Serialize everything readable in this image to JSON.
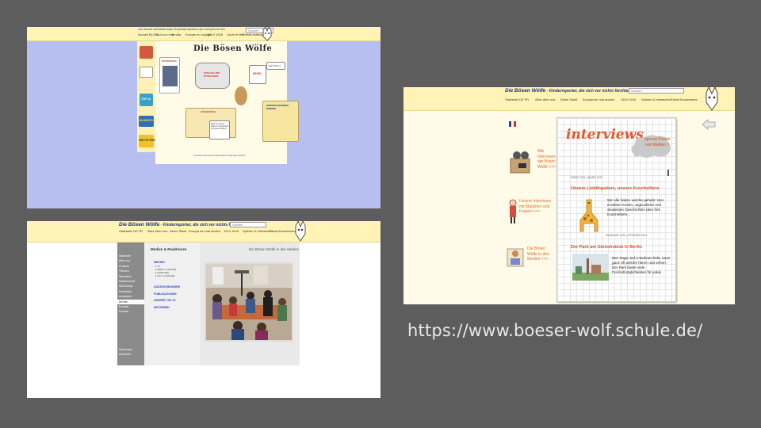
{
  "url_caption": "https://www.boeser-wolf.schule.de/",
  "shot1": {
    "tagline": "Les Grands méchants loups, les jeunes reporters qui n'ont peur de rien",
    "search_value": "Suchen",
    "nav": [
      "Accueil BLOG",
      "Tout sur nous",
      "Ta villa",
      "Europe en voyage",
      "1914 1918",
      "Jouer et fête",
      "Portail enfants"
    ],
    "logo_text": "Die Bösen Wölfe",
    "tiles": {
      "interviews": "INTERVIEWS",
      "spielen": "SPIELEN UND MITMACHEN",
      "news": "NEWS",
      "deutsch": "DEUTSCH",
      "europa": "EUROPA ERLEBEN · WISSEN",
      "frankreich": "FRANKREICH",
      "note": "Bald ist Advent Paket in Frankreich und Deutschland"
    },
    "sidebar": [
      "TOP 10",
      "BLINDE KUH",
      "BETTE ESSEN"
    ],
    "footer": "Kontakt  Impressum  Datenschutz  Sitemap  Partner"
  },
  "shot2": {
    "title_main": "Die Bösen Wölfe",
    "title_sub": " - Kinderreporter, die sich vor nichts fürchten",
    "search_value": "Suchen",
    "nav": [
      "Startseite DE FR",
      "Alles über uns",
      "Deine Stadt",
      "Europa ein mal anders",
      "1914 1918",
      "Spielen & mitmachen",
      "Portal Erwachsene"
    ],
    "panel_title": "Medien & Reaktionen",
    "content_title": "Die Bösen Wölfe in den Medien",
    "left_nav": [
      "Startseite",
      "Über uns",
      "Projekte",
      "Themen",
      "Interviews",
      "Wettbewerbe",
      "Workshops",
      "Interaktion",
      "Austausch",
      "Medien",
      "Kontakt",
      "Kontakt"
    ],
    "left_nav_bottom": [
      "Impressum",
      "Übersicht"
    ],
    "media_links": [
      "MEDIEN",
      "AUSZEICHNUNGEN",
      "PUBLIKATIONEN",
      "UNSERE TOP 10",
      "NETZWERK"
    ],
    "media_sub": [
      "TV",
      "PRINT & ONLINE",
      "HÖRFUNK",
      "ON- & OFFLINE"
    ]
  },
  "shot3": {
    "title_main": "Die Bösen Wölfe",
    "title_sub": " - Kinderreporter, die sich vor nichts fürchten",
    "search_value": "Suchen",
    "nav": [
      "Startseite DE FR",
      "Alles über uns",
      "Deine Stadt",
      "Europa ein mal anders",
      "1914 1918",
      "Spielen & mitmachen",
      "Portal Erwachsene"
    ],
    "heading": "interviews",
    "special": "Spezial Presse und Medien !!",
    "side_links": [
      "Alle Interviews der Bösen Wölfe >>>",
      "Unsere Interviews mit Mädchen und Frauen >>>",
      "Die Bösen Wölfe in den Medien >>>"
    ],
    "date_top": "MÄRZ 2021 | MARS 2021",
    "article1": {
      "title": "Unsere Lieblingstiere, unsere Kuscheltiere",
      "text": "Wir alle haben welche gehabt: Hier erzählen Kinder, Jugendliche und Studenten Geschichten über ihre Kuscheltiere...",
      "date": "FEBRUAR 2021 | FÉVRIER 2021"
    },
    "article2": {
      "title": "Der Park am Gleisdreieck in Berlin",
      "text": "Wer Züge und U-Bahnen liebt, kann ganz oft welche hören und sehen. Der Park bietet viele Freizeitmöglichkeiten für jeden"
    }
  }
}
